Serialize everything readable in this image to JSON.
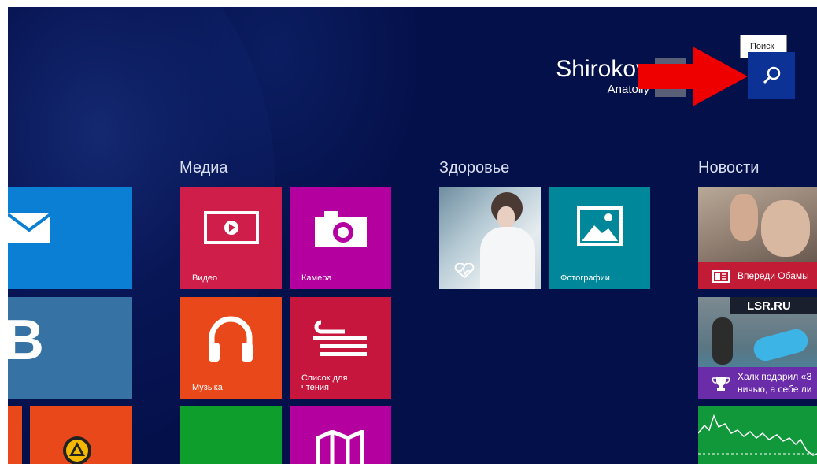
{
  "user": {
    "name": "Shirokov",
    "subname": "Anatoliy"
  },
  "search": {
    "tooltip": "Поиск",
    "icon": "search-icon"
  },
  "groups": {
    "media": "Медиа",
    "health": "Здоровье",
    "news": "Новости"
  },
  "tiles": {
    "mail_icon": "mail-icon",
    "vk_letter": "B",
    "video": "Видео",
    "camera": "Камера",
    "music": "Музыка",
    "reading_line1": "Список для",
    "reading_line2": "чтения",
    "photos": "Фотографии",
    "news1": "Впереди Обамы",
    "news2_line1": "Халк подарил «З",
    "news2_line2": "ничью, а себе ли",
    "sport_banner": "LSR.RU"
  },
  "colors": {
    "background": "#04104a",
    "mail": "#0a7fd3",
    "vk": "#3672a4",
    "video": "#d01e4a",
    "camera": "#b4009e",
    "music": "#e8481a",
    "reading": "#c7163e",
    "health": "#9fb8c5",
    "photos": "#00879a",
    "news": "#c21b35",
    "sport": "#6a2ca8",
    "finance": "#10983a",
    "store_green": "#0e9e2c",
    "annotation_arrow": "#ee0000"
  }
}
